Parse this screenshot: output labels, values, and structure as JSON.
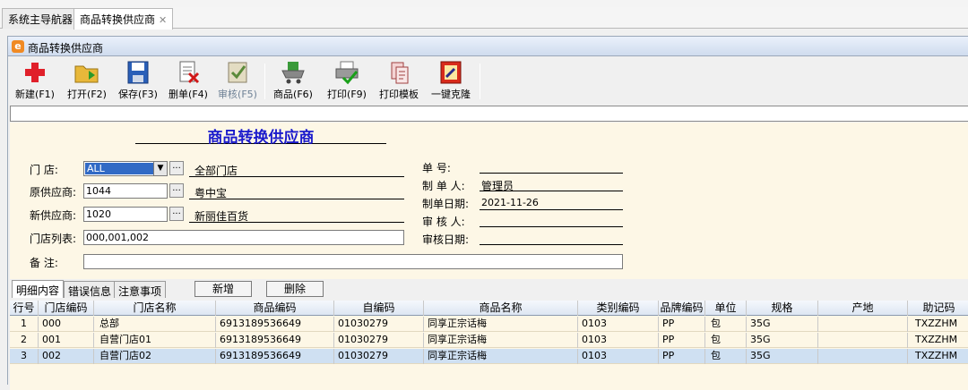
{
  "tabs": [
    "系统主导航器",
    "商品转换供应商"
  ],
  "tab_close": "✕",
  "window": {
    "icon": "e",
    "title": "商品转换供应商"
  },
  "toolbar": [
    {
      "label": "新建(F1)",
      "icon": "new-plus-icon",
      "disabled": false
    },
    {
      "label": "打开(F2)",
      "icon": "open-folder-icon",
      "disabled": false
    },
    {
      "label": "保存(F3)",
      "icon": "save-disk-icon",
      "disabled": false
    },
    {
      "label": "删单(F4)",
      "icon": "delete-doc-icon",
      "disabled": false
    },
    {
      "label": "审核(F5)",
      "icon": "audit-check-icon",
      "disabled": true
    },
    {
      "label": "商品(F6)",
      "icon": "goods-cart-icon",
      "disabled": false
    },
    {
      "label": "打印(F9)",
      "icon": "print-icon",
      "disabled": false
    },
    {
      "label": "打印模板",
      "icon": "print-template-icon",
      "disabled": false
    },
    {
      "label": "一键克隆",
      "icon": "clone-icon",
      "disabled": false
    }
  ],
  "form": {
    "title": "商品转换供应商",
    "store_label": "门    店:",
    "store_value": "ALL",
    "store_name": "全部门店",
    "orig_supplier_label": "原供应商:",
    "orig_supplier_value": "1044",
    "orig_supplier_name": "粤中宝",
    "new_supplier_label": "新供应商:",
    "new_supplier_value": "1020",
    "new_supplier_name": "新丽佳百货",
    "store_list_label": "门店列表:",
    "store_list_value": "000,001,002",
    "remark_label": "备    注:",
    "remark_value": "",
    "doc_no_label": "单    号:",
    "doc_no_value": "",
    "creator_label": "制 单 人:",
    "creator_value": "管理员",
    "date_label": "制单日期:",
    "date_value": "2021-11-26",
    "auditor_label": "审 核 人:",
    "auditor_value": "",
    "audit_date_label": "审核日期:",
    "audit_date_value": ""
  },
  "detail_tabs": [
    "明细内容",
    "错误信息",
    "注意事项"
  ],
  "actions": {
    "add": "新增",
    "delete": "删除"
  },
  "grid": {
    "columns": [
      "行号",
      "门店编码",
      "门店名称",
      "商品编码",
      "自编码",
      "商品名称",
      "类别编码",
      "品牌编码",
      "单位",
      "规格",
      "产地",
      "助记码"
    ],
    "rows": [
      [
        "1",
        "000",
        "总部",
        "6913189536649",
        "01030279",
        "同享正宗话梅",
        "0103",
        "PP",
        "包",
        "35G",
        "",
        "TXZZHM"
      ],
      [
        "2",
        "001",
        "自营门店01",
        "6913189536649",
        "01030279",
        "同享正宗话梅",
        "0103",
        "PP",
        "包",
        "35G",
        "",
        "TXZZHM"
      ],
      [
        "3",
        "002",
        "自营门店02",
        "6913189536649",
        "01030279",
        "同享正宗话梅",
        "0103",
        "PP",
        "包",
        "35G",
        "",
        "TXZZHM"
      ]
    ]
  },
  "colors": {
    "form_bg": "#fdf7e6",
    "title_blue": "#1a1acc",
    "selected_row": "#cfe0f2"
  }
}
